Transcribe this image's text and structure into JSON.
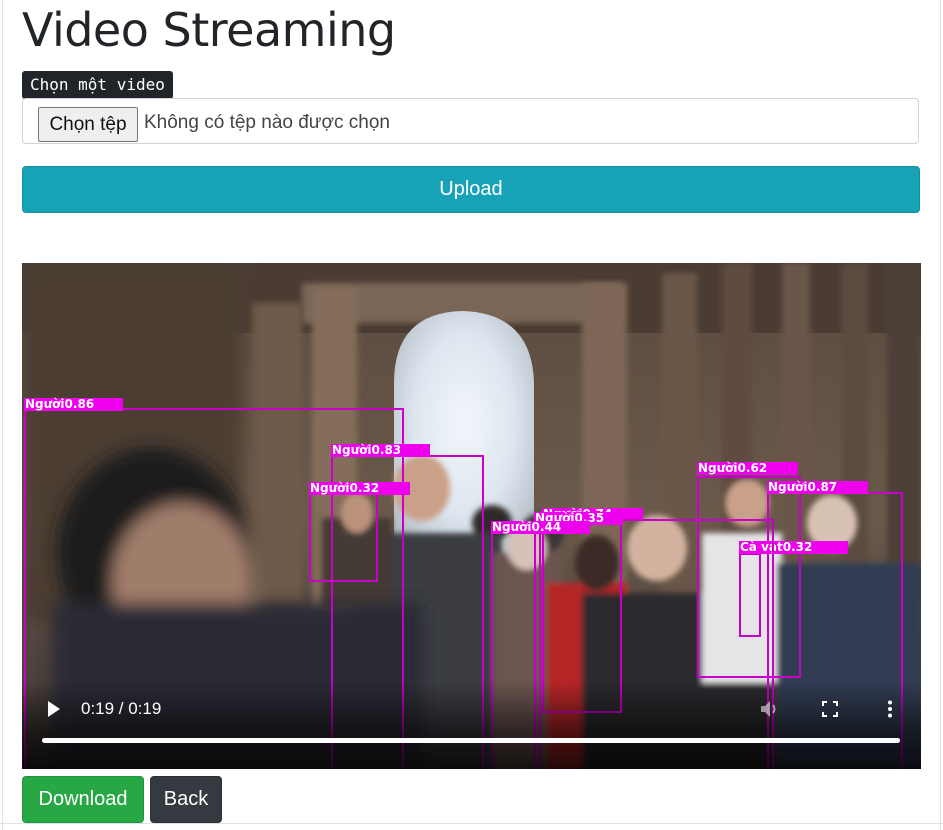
{
  "page": {
    "title": "Video Streaming"
  },
  "upload_form": {
    "file_label": "Chọn một video",
    "choose_button": "Chọn tệp",
    "file_status": "Không có tệp nào được chọn",
    "upload_button": "Upload"
  },
  "video": {
    "time_display": "0:19 / 0:19",
    "progress": 1.0,
    "detections": [
      {
        "label": "Người0.86"
      },
      {
        "label": "Người0.83"
      },
      {
        "label": "Người0.32"
      },
      {
        "label": "Người0.62"
      },
      {
        "label": "Người0.87"
      },
      {
        "label": "Cà vạt0.32"
      },
      {
        "label": "Người0.74"
      },
      {
        "label": "Người0.35"
      },
      {
        "label": "Người0.44"
      }
    ]
  },
  "actions": {
    "download_button": "Download",
    "back_button": "Back"
  },
  "colors": {
    "upload": "#17a2b8",
    "download": "#28a745",
    "back": "#343a40",
    "detection": "#ee00ee"
  }
}
